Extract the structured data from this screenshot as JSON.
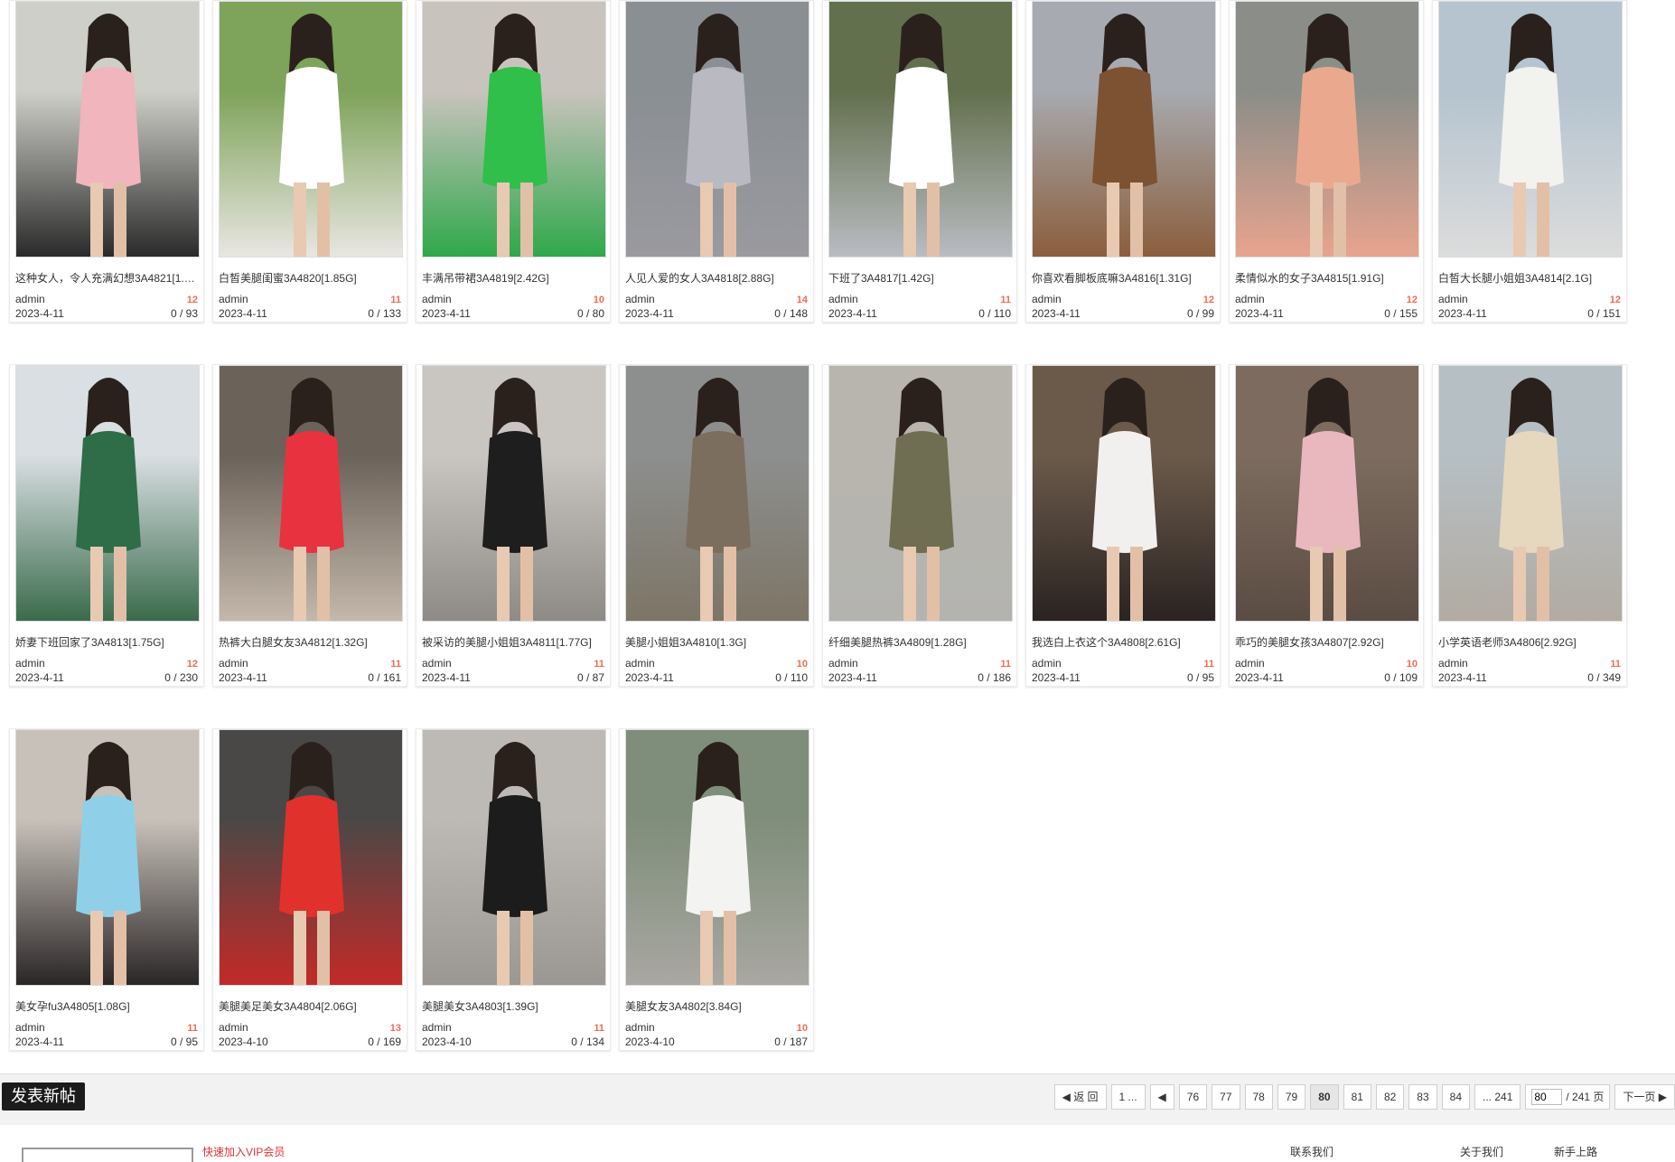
{
  "threads": [
    {
      "title": "这种女人，令人充满幻想3A4821[1.…",
      "author": "admin",
      "badge": "12",
      "date": "2023-4-11",
      "counts": "0 / 93",
      "top": "#cfcfc9",
      "bottom": "#2a2a2a",
      "accent": "#f0b5bd"
    },
    {
      "title": "白皙美腿闺蜜3A4820[1.85G]",
      "author": "admin",
      "badge": "11",
      "date": "2023-4-11",
      "counts": "0 / 133",
      "top": "#7ea35a",
      "bottom": "#e9e6e2",
      "accent": "#ffffff"
    },
    {
      "title": "丰满吊带裙3A4819[2.42G]",
      "author": "admin",
      "badge": "10",
      "date": "2023-4-11",
      "counts": "0 / 80",
      "top": "#c9c3bd",
      "bottom": "#2fa84a",
      "accent": "#2fbf4a"
    },
    {
      "title": "人见人爱的女人3A4818[2.88G]",
      "author": "admin",
      "badge": "14",
      "date": "2023-4-11",
      "counts": "0 / 148",
      "top": "#8a8f94",
      "bottom": "#9a9a9f",
      "accent": "#b9b9c2"
    },
    {
      "title": "下班了3A4817[1.42G]",
      "author": "admin",
      "badge": "11",
      "date": "2023-4-11",
      "counts": "0 / 110",
      "top": "#63704e",
      "bottom": "#b9bcc2",
      "accent": "#ffffff"
    },
    {
      "title": "你喜欢看脚板底嘛3A4816[1.31G]",
      "author": "admin",
      "badge": "12",
      "date": "2023-4-11",
      "counts": "0 / 99",
      "top": "#a7aab0",
      "bottom": "#8b5e3c",
      "accent": "#7c5232"
    },
    {
      "title": "柔情似水的女子3A4815[1.91G]",
      "author": "admin",
      "badge": "12",
      "date": "2023-4-11",
      "counts": "0 / 155",
      "top": "#8b8d88",
      "bottom": "#e7a48e",
      "accent": "#eaa98f"
    },
    {
      "title": "白皙大长腿小姐姐3A4814[2.1G]",
      "author": "admin",
      "badge": "12",
      "date": "2023-4-11",
      "counts": "0 / 151",
      "top": "#b5c4cf",
      "bottom": "#dcdcdc",
      "accent": "#f2f2ee"
    },
    {
      "title": "娇妻下班回家了3A4813[1.75G]",
      "author": "admin",
      "badge": "12",
      "date": "2023-4-11",
      "counts": "0 / 230",
      "top": "#d9dfe2",
      "bottom": "#3a6b4c",
      "accent": "#2f6d49"
    },
    {
      "title": "热裤大白腿女友3A4812[1.32G]",
      "author": "admin",
      "badge": "11",
      "date": "2023-4-11",
      "counts": "0 / 161",
      "top": "#6b6259",
      "bottom": "#c4b8ab",
      "accent": "#e8323f"
    },
    {
      "title": "被采访的美腿小姐姐3A4811[1.77G]",
      "author": "admin",
      "badge": "11",
      "date": "2023-4-11",
      "counts": "0 / 87",
      "top": "#c9c6c2",
      "bottom": "#8e8a86",
      "accent": "#1e1e1e"
    },
    {
      "title": "美腿小姐姐3A4810[1.3G]",
      "author": "admin",
      "badge": "10",
      "date": "2023-4-11",
      "counts": "0 / 110",
      "top": "#8d8f8e",
      "bottom": "#7d7566",
      "accent": "#7b6e5e"
    },
    {
      "title": "纤细美腿热裤3A4809[1.28G]",
      "author": "admin",
      "badge": "11",
      "date": "2023-4-11",
      "counts": "0 / 186",
      "top": "#b8b5ae",
      "bottom": "#b3b3b0",
      "accent": "#6f6e52"
    },
    {
      "title": "我选白上衣这个3A4808[2.61G]",
      "author": "admin",
      "badge": "11",
      "date": "2023-4-11",
      "counts": "0 / 95",
      "top": "#6b5a4a",
      "bottom": "#2a2322",
      "accent": "#f2f0ee"
    },
    {
      "title": "乖巧的美腿女孩3A4807[2.92G]",
      "author": "admin",
      "badge": "10",
      "date": "2023-4-11",
      "counts": "0 / 109",
      "top": "#7c6b5e",
      "bottom": "#5b4c43",
      "accent": "#e9b8bf"
    },
    {
      "title": "小学英语老师3A4806[2.92G]",
      "author": "admin",
      "badge": "11",
      "date": "2023-4-11",
      "counts": "0 / 349",
      "top": "#b6bfc3",
      "bottom": "#b2aba2",
      "accent": "#e6d7bf"
    },
    {
      "title": "美女孕fu3A4805[1.08G]",
      "author": "admin",
      "badge": "11",
      "date": "2023-4-11",
      "counts": "0 / 95",
      "top": "#c8c1ba",
      "bottom": "#2a2626",
      "accent": "#8fd0e8"
    },
    {
      "title": "美腿美足美女3A4804[2.06G]",
      "author": "admin",
      "badge": "13",
      "date": "2023-4-10",
      "counts": "0 / 169",
      "top": "#4a4846",
      "bottom": "#c22a28",
      "accent": "#e0312d"
    },
    {
      "title": "美腿美女3A4803[1.39G]",
      "author": "admin",
      "badge": "11",
      "date": "2023-4-10",
      "counts": "0 / 134",
      "top": "#bdbab5",
      "bottom": "#9b9792",
      "accent": "#1c1c1c"
    },
    {
      "title": "美腿女友3A4802[3.84G]",
      "author": "admin",
      "badge": "10",
      "date": "2023-4-10",
      "counts": "0 / 187",
      "top": "#7f8e7a",
      "bottom": "#a9a7a2",
      "accent": "#f3f3f1"
    }
  ],
  "actions": {
    "new_post": "发表新帖"
  },
  "pagination": {
    "back": "返 回",
    "first": "1 ...",
    "pages": [
      "76",
      "77",
      "78",
      "79",
      "80",
      "81",
      "82",
      "83",
      "84"
    ],
    "current": "80",
    "last": "... 241",
    "jump_value": "80",
    "total": "/ 241 页",
    "next": "下一页"
  },
  "footer": {
    "vip_text": "快速加入VIP会员",
    "link1": "联系我们",
    "link2": "关于我们",
    "link3": "新手上路"
  }
}
